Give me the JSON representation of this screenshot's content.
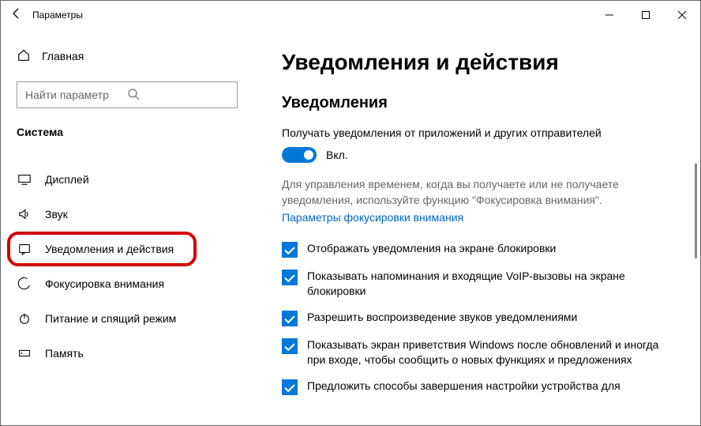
{
  "titlebar": {
    "title": "Параметры"
  },
  "home_label": "Главная",
  "search_placeholder": "Найти параметр",
  "section": "Система",
  "sidebar": [
    {
      "label": "Дисплей"
    },
    {
      "label": "Звук"
    },
    {
      "label": "Уведомления и действия"
    },
    {
      "label": "Фокусировка внимания"
    },
    {
      "label": "Питание и спящий режим"
    },
    {
      "label": "Память"
    }
  ],
  "content": {
    "h1": "Уведомления и действия",
    "h2": "Уведомления",
    "notif_desc": "Получать уведомления от приложений и других отправителей",
    "toggle_state": "Вкл.",
    "focus_desc": "Для управления временем, когда вы получаете или не получаете уведомления, используйте функцию \"Фокусировка внимания\".",
    "focus_link": "Параметры фокусировки внимания",
    "checks": [
      "Отображать уведомления на экране блокировки",
      "Показывать напоминания и входящие VoIP-вызовы на экране блокировки",
      "Разрешить  воспроизведение звуков уведомлениями",
      "Показывать экран приветствия Windows после обновлений и иногда при входе, чтобы сообщить о новых функциях и предложениях",
      "Предложить способы завершения настройки устройства для"
    ]
  }
}
